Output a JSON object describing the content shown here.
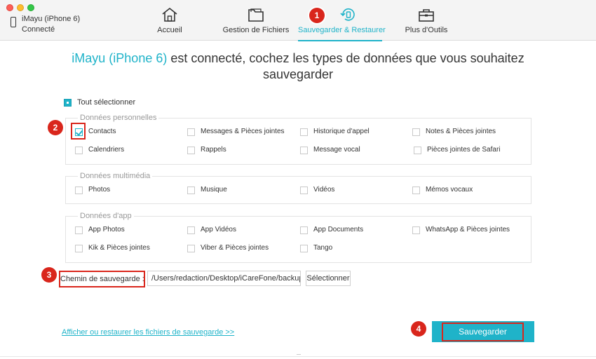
{
  "device": {
    "name": "iMayu (iPhone 6)",
    "status": "Connecté"
  },
  "nav": [
    {
      "label": "Accueil",
      "icon": "home-icon",
      "active": false
    },
    {
      "label": "Gestion de Fichiers",
      "icon": "folder-icon",
      "active": false
    },
    {
      "label": "Sauvegarder & Restaurer",
      "icon": "backup-restore-icon",
      "active": true
    },
    {
      "label": "Plus d'Outils",
      "icon": "toolbox-icon",
      "active": false
    }
  ],
  "markers": [
    "1",
    "2",
    "3",
    "4"
  ],
  "title": {
    "device": "iMayu (iPhone 6)",
    "rest": " est connecté, cochez les types de données que vous souhaitez sauvegarder"
  },
  "select_all": {
    "label": "Tout sélectionner",
    "checked": true
  },
  "groups": [
    {
      "title": "Données personnelles",
      "items": [
        {
          "label": "Contacts",
          "checked": true
        },
        {
          "label": "Messages & Pièces jointes",
          "checked": false
        },
        {
          "label": "Historique d'appel",
          "checked": false
        },
        {
          "label": "Notes & Pièces jointes",
          "checked": false
        },
        {
          "label": "Calendriers",
          "checked": false
        },
        {
          "label": "Rappels",
          "checked": false
        },
        {
          "label": "Message vocal",
          "checked": false
        },
        {
          "label": "Pièces jointes de Safari",
          "checked": false
        }
      ]
    },
    {
      "title": "Données multimédia",
      "items": [
        {
          "label": "Photos",
          "checked": false
        },
        {
          "label": "Musique",
          "checked": false
        },
        {
          "label": "Vidéos",
          "checked": false
        },
        {
          "label": "Mémos vocaux",
          "checked": false
        }
      ]
    },
    {
      "title": "Données d'app",
      "items": [
        {
          "label": "App Photos",
          "checked": false
        },
        {
          "label": "App Vidéos",
          "checked": false
        },
        {
          "label": "App Documents",
          "checked": false
        },
        {
          "label": "WhatsApp & Pièces jointes",
          "checked": false
        },
        {
          "label": "Kik & Pièces jointes",
          "checked": false
        },
        {
          "label": "Viber & Pièces jointes",
          "checked": false
        },
        {
          "label": "Tango",
          "checked": false
        }
      ]
    }
  ],
  "backup_path": {
    "label": "Chemin de sauvegarde :",
    "value": "/Users/redaction/Desktop/iCareFone/backup",
    "button": "Sélectionner"
  },
  "restore_link": "Afficher ou restaurer les fichiers de sauvegarde >>",
  "save_button": "Sauvegarder",
  "colors": {
    "accent": "#1fb3c9",
    "marker": "#d9261c"
  }
}
